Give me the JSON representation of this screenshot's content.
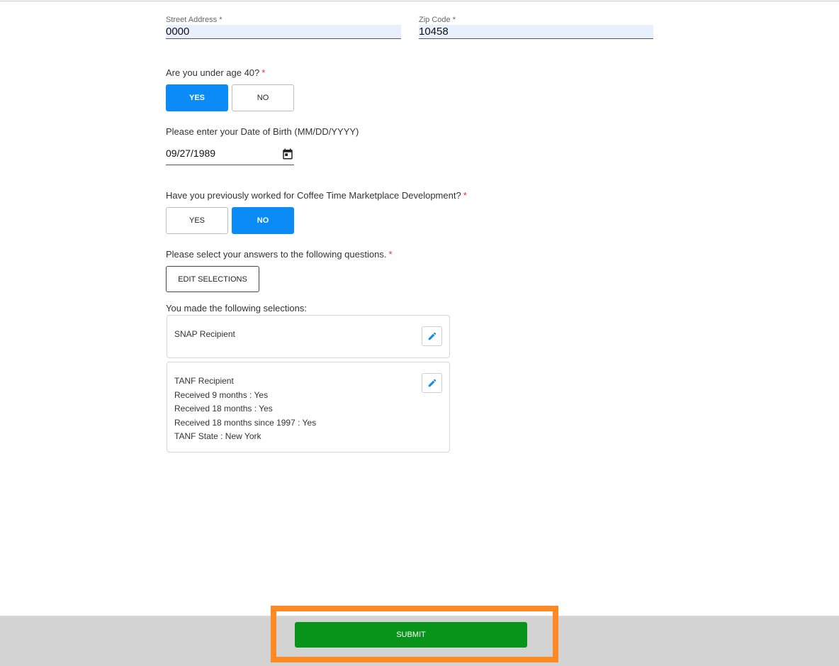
{
  "address": {
    "street": {
      "label": "Street Address *",
      "value": "0000"
    },
    "zip": {
      "label": "Zip Code *",
      "value": "10458"
    }
  },
  "under_40": {
    "question": "Are you under age 40?",
    "required_mark": "*",
    "yes_label": "YES",
    "no_label": "NO",
    "selected": "YES"
  },
  "dob": {
    "question": "Please enter your Date of Birth (MM/DD/YYYY)",
    "value": "09/27/1989",
    "icon": "calendar-icon"
  },
  "worked_before": {
    "question": "Have you previously worked for Coffee Time Marketplace Development?",
    "required_mark": "*",
    "yes_label": "YES",
    "no_label": "NO",
    "selected": "NO"
  },
  "questions": {
    "prompt": "Please select your answers to the following questions.",
    "required_mark": "*",
    "edit_label": "EDIT SELECTIONS"
  },
  "selections": {
    "heading": "You made the following selections:",
    "cards": [
      {
        "lines": [
          "SNAP Recipient"
        ],
        "icon": "pencil-icon"
      },
      {
        "lines": [
          "TANF Recipient",
          "Received 9 months : Yes",
          "Received 18 months : Yes",
          "Received 18 months since 1997 : Yes",
          "TANF State : New York"
        ],
        "icon": "pencil-icon"
      }
    ]
  },
  "footer": {
    "submit_label": "SUBMIT",
    "highlight_color": "#ff8a24",
    "submit_color": "#08941b",
    "accent_color": "#0a8bf5"
  }
}
